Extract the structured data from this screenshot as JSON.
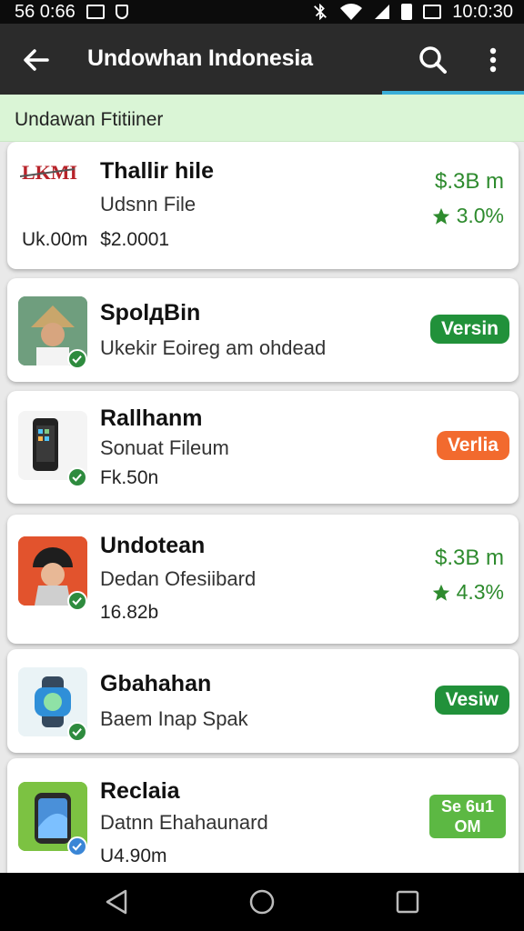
{
  "status_bar": {
    "left_text": "56 0:66",
    "time": "10:0:30",
    "icons": [
      "notification-box-icon",
      "shield-icon",
      "bluetooth-off-icon",
      "wifi-icon",
      "signal-icon",
      "battery-icon"
    ]
  },
  "app_bar": {
    "title": "Undowhan Indonesia",
    "icons": [
      "back-arrow-icon",
      "search-icon",
      "more-vert-icon"
    ]
  },
  "filter_bar": {
    "label": "Undawan Ftitiiner"
  },
  "items": [
    {
      "logo_text": "LKMI",
      "title": "Thallir hile",
      "subtitle": "Udsnn File",
      "meta_left": "Uk.00m",
      "meta_right": "$2.0001",
      "price": "$.3B m",
      "rating": "3.0%"
    },
    {
      "title": "SpolдBin",
      "subtitle": "Ukekir Eoireg am ohdead",
      "badge": "Versin",
      "badge_color": "#21913a"
    },
    {
      "title": "Rallhanm",
      "subtitle": "Sonuat Fileum",
      "meta": "Fk.50n",
      "badge": "Verlia",
      "badge_color": "#f26a2e"
    },
    {
      "title": "Undotean",
      "subtitle": "Dedan Ofesiibard",
      "meta": "16.82b",
      "price": "$.3B m",
      "rating": "4.3%"
    },
    {
      "title": "Gbahahan",
      "subtitle": "Baem Inap Spak",
      "badge": "Vesiw",
      "badge_color": "#21913a"
    },
    {
      "title": "Reclaia",
      "subtitle": "Datnn Ehahaunard",
      "meta": "U4.90m",
      "badge": "Se 6u1 OM",
      "badge_line1": "Se 6u1",
      "badge_line2": "OM",
      "badge_color": "#5cb843"
    }
  ],
  "colors": {
    "accent_green": "#2e8b2e",
    "appbar": "#2b2b2b",
    "filter_bg": "#daf5d6",
    "tab_indicator": "#3aaed8"
  },
  "nav_bar": {
    "icons": [
      "back-triangle-icon",
      "home-circle-icon",
      "recents-square-icon"
    ]
  }
}
